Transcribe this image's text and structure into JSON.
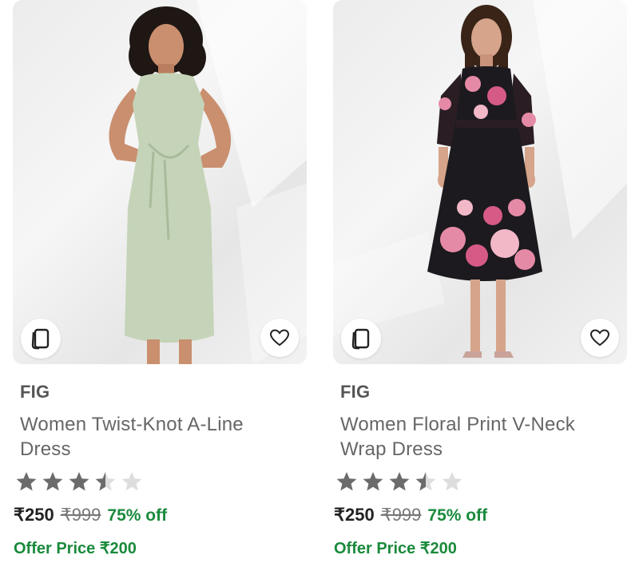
{
  "products": [
    {
      "brand": "FIG",
      "title": "Women Twist-Knot A-Line Dress",
      "rating": 3.5,
      "rating_max": 5,
      "price": "₹250",
      "mrp": "₹999",
      "discount": "75% off",
      "offer_price": "Offer Price ₹200",
      "similar_icon": "similar-products-icon",
      "wishlist_icon": "heart-outline-icon",
      "dress_color": "#c5d4b8"
    },
    {
      "brand": "FIG",
      "title": "Women Floral Print V-Neck Wrap Dress",
      "rating": 3.5,
      "rating_max": 5,
      "price": "₹250",
      "mrp": "₹999",
      "discount": "75% off",
      "offer_price": "Offer Price ₹200",
      "similar_icon": "similar-products-icon",
      "wishlist_icon": "heart-outline-icon",
      "dress_color": "#1c1a1e"
    }
  ],
  "colors": {
    "star_filled": "#6b6b6b",
    "star_empty": "#dddddd",
    "discount_green": "#1a8a3c"
  }
}
